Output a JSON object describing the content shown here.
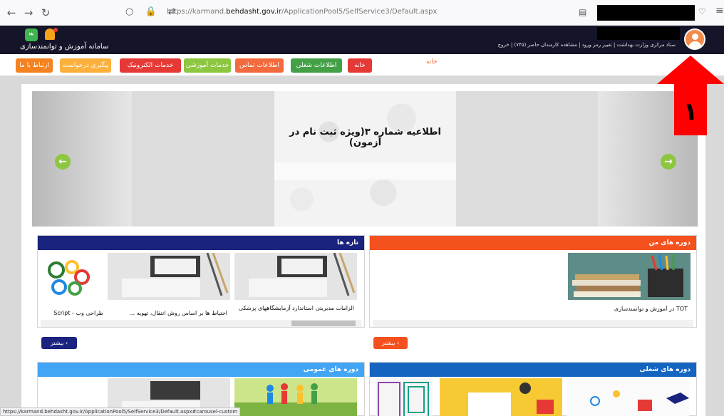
{
  "browser": {
    "url_prefix": "https://karmand.",
    "url_domain": "behdasht.gov.ir",
    "url_path": "/ApplicationPool5/SelfService3/Default.aspx"
  },
  "header": {
    "site_title": "سامانه آموزش و توانمندسازی",
    "user_links": "ستاد مرکزی وزارت بهداشت | تغییر رمز ورود | مشاهده کارمندان حاضر (۷۴۵) | خروج"
  },
  "nav": {
    "items": [
      {
        "label": "ارتباط با ما",
        "color": "#f58220"
      },
      {
        "label": "پیگیری درخواست",
        "color": "#fbb03b"
      },
      {
        "label": "خدمات الکترونیک",
        "color": "#e53935"
      },
      {
        "label": "خدمات آموزشی",
        "color": "#8dc63f"
      },
      {
        "label": "اطلاعات تماس",
        "color": "#f26a3d"
      },
      {
        "label": "اطلاعات شغلی",
        "color": "#43a047"
      },
      {
        "label": "خانه",
        "color": "#e53935"
      }
    ],
    "breadcrumb": "خانه"
  },
  "carousel": {
    "slide_title": "اطلاعیه شماره ۳(ویژه ثبت نام در آزمون)"
  },
  "panels": {
    "news": {
      "title": "تازه ها",
      "color": "#1a237e",
      "cards": [
        {
          "title": "الزامات مدیریتی استاندارد آزمایشگاههای پزشکی"
        },
        {
          "title": "احتیاط ها بر اساس روش انتقال، تهویه ..."
        },
        {
          "title": "طراحی وب - Script"
        }
      ],
      "more_label": "بیشتر",
      "more_color": "#1a237e"
    },
    "my_courses": {
      "title": "دوره های من",
      "color": "#f4511e",
      "cards": [
        {
          "title": "TOT در آموزش و توانمندسازی"
        }
      ],
      "more_label": "بیشتر",
      "more_color": "#f4511e"
    },
    "general_courses": {
      "title": "دوره های عمومی",
      "color": "#42a5f5"
    },
    "job_courses": {
      "title": "دوره های شغلی",
      "color": "#1565c0"
    }
  },
  "status_url": "https://karmand.behdasht.gov.ir/ApplicationPool5/SelfService3/Default.aspx#carousel-custom",
  "annotation": {
    "number": "۱",
    "color": "#ff0000"
  }
}
